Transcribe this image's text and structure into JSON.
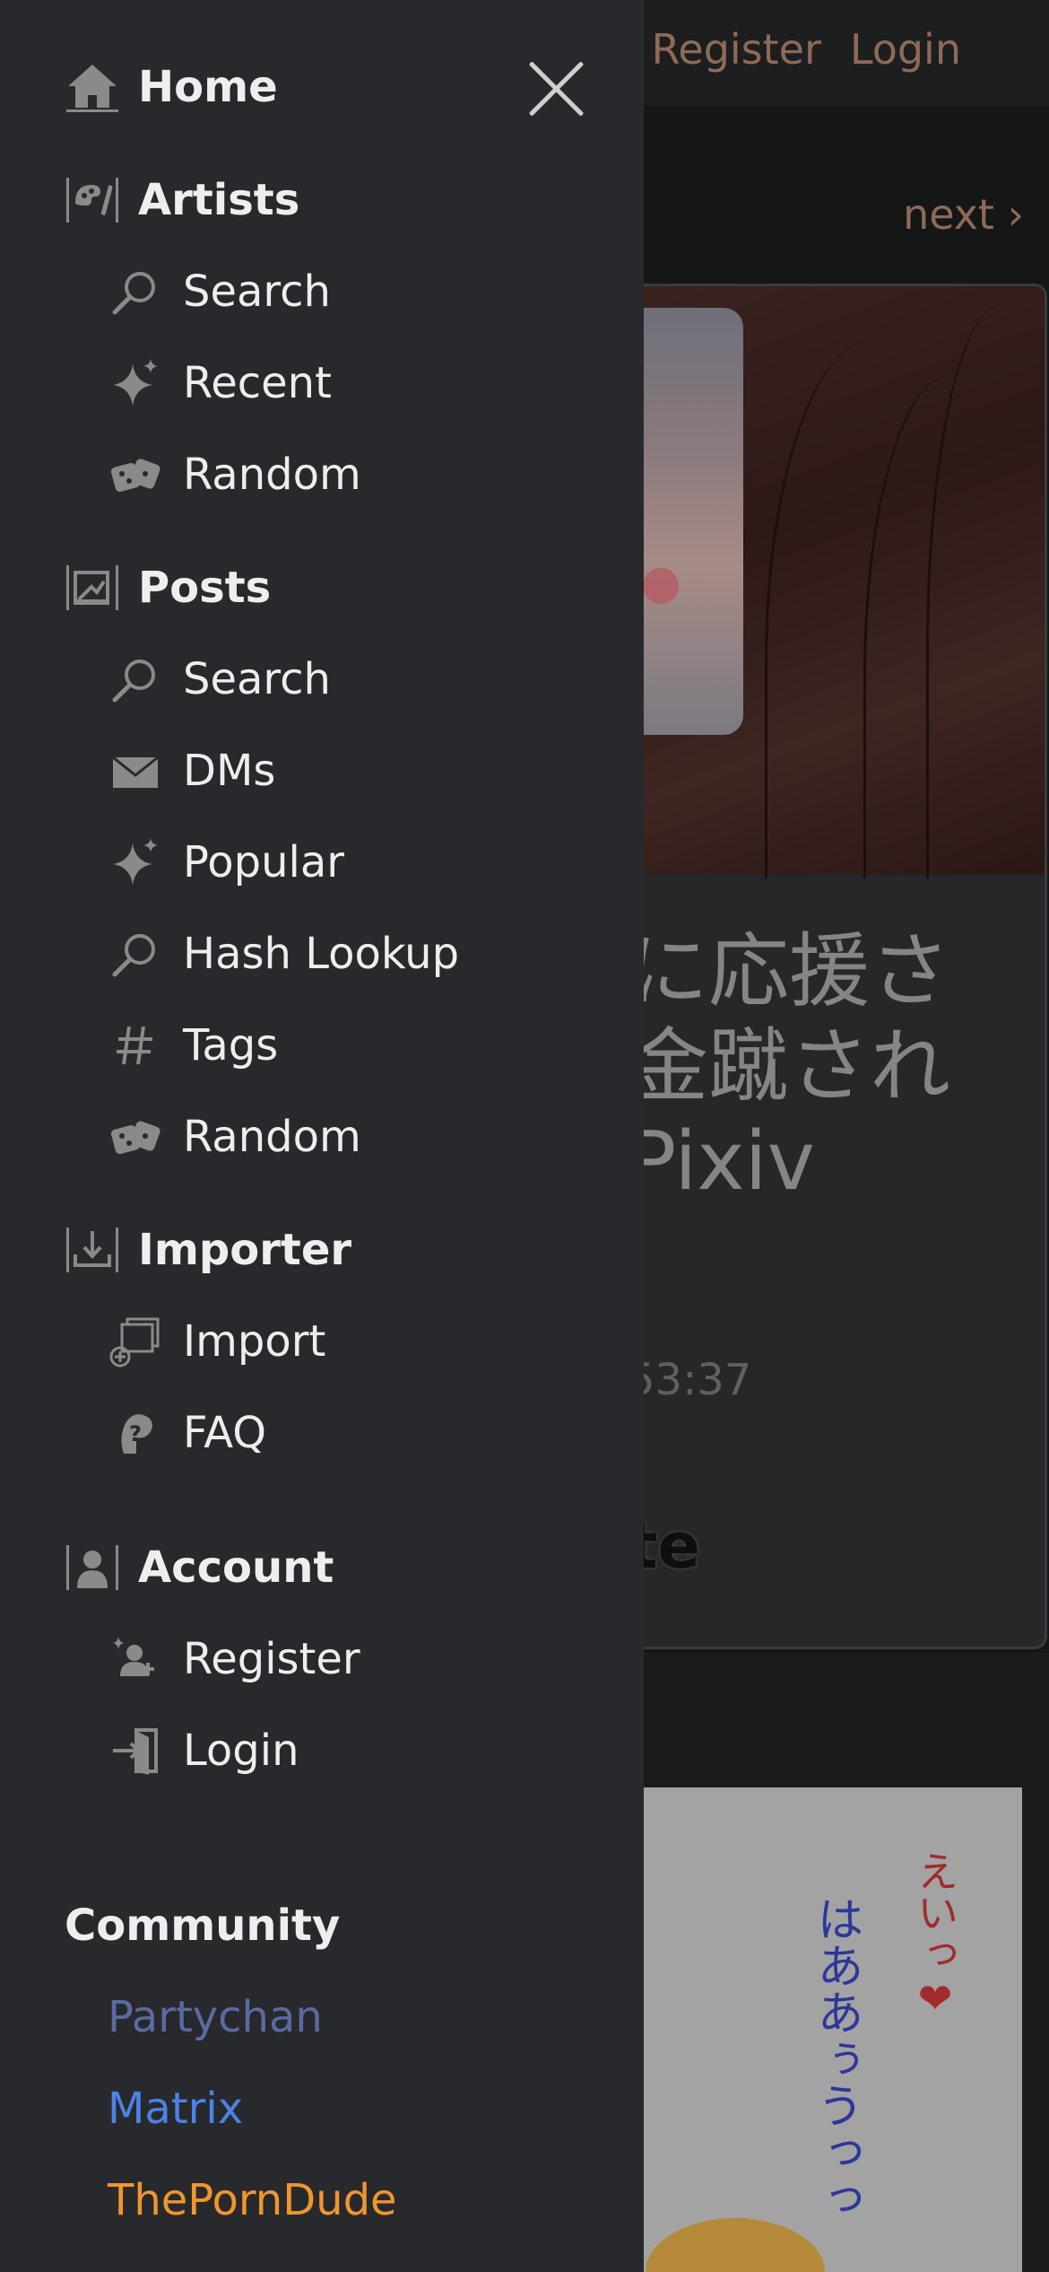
{
  "background": {
    "nav": {
      "register": "Register",
      "login": "Login"
    },
    "pager": {
      "next": "next ›"
    },
    "post": {
      "title_lines": [
        "に応援さ",
        "金蹴され",
        "Pixiv"
      ],
      "time": "53:37",
      "note": "te"
    },
    "manga": {
      "text_red": "えいっ❤",
      "text_blue": "はああぅうっっ"
    }
  },
  "drawer": {
    "home": {
      "label": "Home",
      "icon": "home-icon"
    },
    "artists": {
      "label": "Artists",
      "icon": "palette-icon",
      "items": [
        {
          "label": "Search",
          "icon": "search-icon"
        },
        {
          "label": "Recent",
          "icon": "sparkle-icon"
        },
        {
          "label": "Random",
          "icon": "dice-icon"
        }
      ]
    },
    "posts": {
      "label": "Posts",
      "icon": "posts-icon",
      "items": [
        {
          "label": "Search",
          "icon": "search-icon"
        },
        {
          "label": "DMs",
          "icon": "envelope-icon"
        },
        {
          "label": "Popular",
          "icon": "sparkle-icon"
        },
        {
          "label": "Hash Lookup",
          "icon": "search-icon"
        },
        {
          "label": "Tags",
          "icon": "hash-icon"
        },
        {
          "label": "Random",
          "icon": "dice-icon"
        }
      ]
    },
    "importer": {
      "label": "Importer",
      "icon": "importer-icon",
      "items": [
        {
          "label": "Import",
          "icon": "import-icon"
        },
        {
          "label": "FAQ",
          "icon": "faq-icon"
        }
      ]
    },
    "account": {
      "label": "Account",
      "icon": "account-icon",
      "items": [
        {
          "label": "Register",
          "icon": "register-icon"
        },
        {
          "label": "Login",
          "icon": "login-icon"
        }
      ]
    },
    "community": {
      "label": "Community",
      "links": [
        {
          "label": "Partychan",
          "color": "#5b6aa3"
        },
        {
          "label": "Matrix",
          "color": "#4c82e6"
        },
        {
          "label": "ThePornDude",
          "color": "#f0962e"
        }
      ]
    }
  },
  "colors": {
    "drawer_bg": "#28292c",
    "text": "#eeeeee",
    "icon": "#8a8a8a",
    "accent_muted": "#8e6a57"
  }
}
